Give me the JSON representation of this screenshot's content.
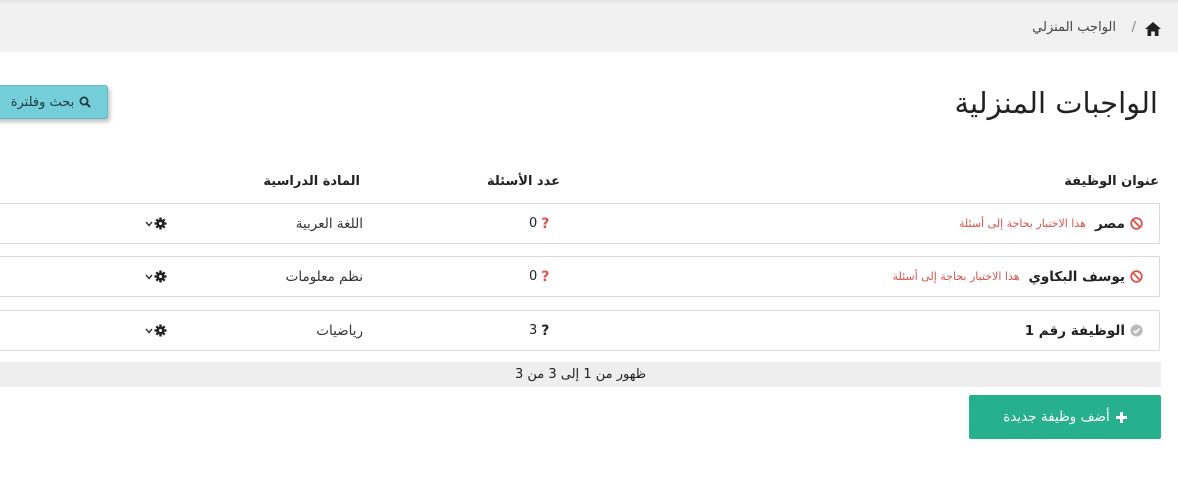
{
  "breadcrumb": {
    "home_icon": "home-icon",
    "separator": "/",
    "current": "الواجب المنزلي"
  },
  "page_title": "الواجبات المنزلية",
  "search_button": {
    "label": "بحث وفلترة",
    "icon": "search-icon"
  },
  "table": {
    "headers": {
      "title": "عنوان الوظيفة",
      "questions": "عدد الأسئلة",
      "subject": "المادة الدراسية"
    },
    "rows": [
      {
        "title": "مصر",
        "warning": "هذا الاختبار بحاجة إلى أسئلة",
        "status_icon": "ban-icon",
        "status_color": "#d9534f",
        "questions": "0",
        "q_color": "#d9534f",
        "subject": "اللغة العربية"
      },
      {
        "title": "يوسف البكاوي",
        "warning": "هذا الاختبار بحاجة إلى أسئلة",
        "status_icon": "ban-icon",
        "status_color": "#d9534f",
        "questions": "0",
        "q_color": "#d9534f",
        "subject": "نظم معلومات"
      },
      {
        "title": "الوظيفة رقم 1",
        "warning": "",
        "status_icon": "check-circle-icon",
        "status_color": "#bbbbbb",
        "questions": "3",
        "q_color": "#222222",
        "subject": "رياضيات"
      }
    ]
  },
  "pagination": "ظهور من 1 إلى 3 من 3",
  "add_button": {
    "label": "أضف وظيفة جديدة",
    "icon": "plus-icon"
  },
  "colors": {
    "accent_green": "#26b08e",
    "search_teal": "#74cfd8",
    "danger": "#d9534f"
  }
}
